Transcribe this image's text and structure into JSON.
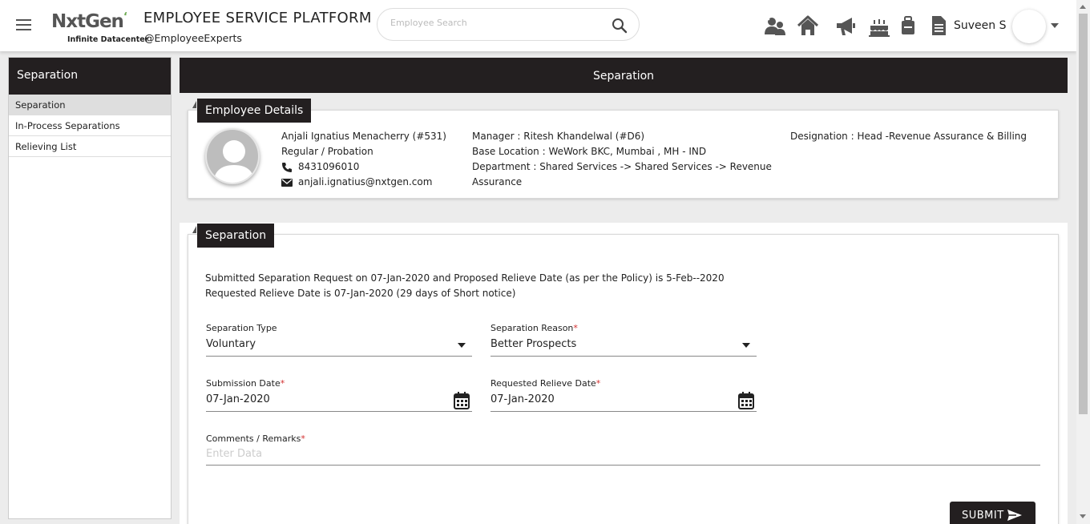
{
  "header": {
    "logo_main": "NxtGen",
    "logo_sub": "Infinite Datacenter",
    "title": "EMPLOYEE SERVICE PLATFORM",
    "subtitle": "@EmployeeExperts",
    "search_placeholder": "Employee Search",
    "user_name": "Suveen S",
    "icons": [
      "team-icon",
      "home-icon",
      "megaphone-icon",
      "cake-icon",
      "luggage-icon",
      "document-icon"
    ]
  },
  "sidebar": {
    "title": "Separation",
    "items": [
      {
        "label": "Separation",
        "active": true
      },
      {
        "label": "In-Process Separations",
        "active": false
      },
      {
        "label": "Relieving List",
        "active": false
      }
    ]
  },
  "main": {
    "title": "Separation"
  },
  "employee_details": {
    "section_title": "Employee Details",
    "name": "Anjali Ignatius Menacherry (#531)",
    "employment_type": "Regular / Probation",
    "phone": "8431096010",
    "email": "anjali.ignatius@nxtgen.com",
    "manager": "Manager : Ritesh Khandelwal (#D6)",
    "base_location": "Base Location : WeWork BKC, Mumbai , MH - IND",
    "department_line1": "Department : Shared Services -> Shared Services -> Revenue",
    "department_line2": "Assurance",
    "designation": "Designation : Head -Revenue Assurance & Billing"
  },
  "separation": {
    "section_title": "Separation",
    "message_line1": "Submitted Separation Request on 07-Jan-2020 and Proposed Relieve Date (as per the Policy) is 5-Feb--2020",
    "message_line2": "Requested Relieve Date is 07-Jan-2020 (29 days of Short notice)",
    "type_label": "Separation Type",
    "type_value": "Voluntary",
    "reason_label": "Separation Reason",
    "reason_value": "Better Prospects",
    "submission_label": "Submission Date",
    "submission_value": "07-Jan-2020",
    "relieve_label": "Requested Relieve Date",
    "relieve_value": "07-Jan-2020",
    "comments_label": "Comments / Remarks",
    "comments_placeholder": "Enter Data",
    "required_mark": "*",
    "submit_label": "SUBMIT"
  },
  "colors": {
    "dark": "#231f20",
    "required": "#d32f2f",
    "logo_accent": "#6aa84f"
  }
}
